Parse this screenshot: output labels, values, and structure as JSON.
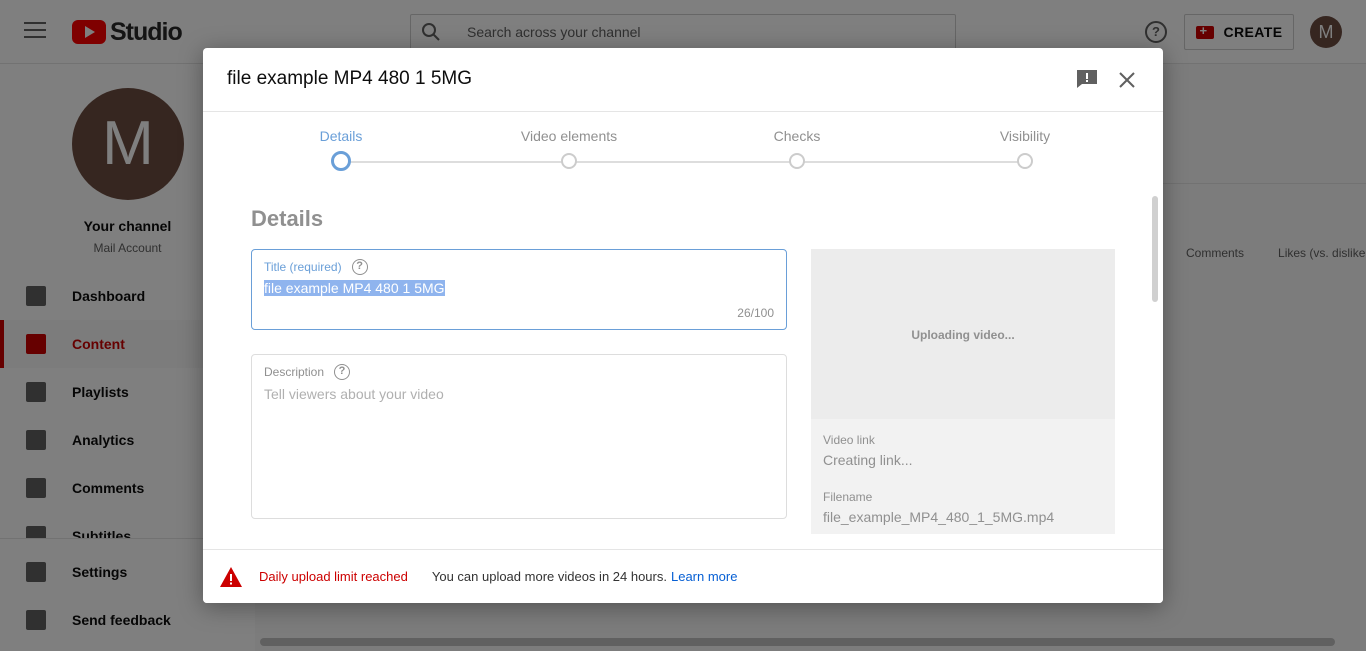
{
  "topbar": {
    "studio_label": "Studio",
    "search_placeholder": "Search across your channel",
    "create_label": "CREATE",
    "avatar_letter": "M"
  },
  "sidebar": {
    "avatar_letter": "M",
    "your_channel": "Your channel",
    "account_name": "Mail Account",
    "items": [
      {
        "label": "Dashboard",
        "icon": "dashboard-icon"
      },
      {
        "label": "Content",
        "icon": "content-icon",
        "active": true
      },
      {
        "label": "Playlists",
        "icon": "playlists-icon"
      },
      {
        "label": "Analytics",
        "icon": "analytics-icon"
      },
      {
        "label": "Comments",
        "icon": "comments-icon"
      },
      {
        "label": "Subtitles",
        "icon": "subtitles-icon"
      }
    ],
    "bottom_items": [
      {
        "label": "Settings",
        "icon": "gear-icon"
      },
      {
        "label": "Send feedback",
        "icon": "feedback-icon"
      }
    ]
  },
  "content": {
    "columns": [
      "Comments",
      "Likes (vs. dislike..."
    ]
  },
  "dialog": {
    "title": "file example MP4 480 1 5MG",
    "steps": [
      "Details",
      "Video elements",
      "Checks",
      "Visibility"
    ],
    "active_step": "Details",
    "section_title": "Details",
    "title_field": {
      "label": "Title (required)",
      "value": "file example MP4 480 1 5MG",
      "counter": "26/100"
    },
    "description_field": {
      "label": "Description",
      "placeholder": "Tell viewers about your video"
    },
    "preview": {
      "status": "Uploading video...",
      "video_link_label": "Video link",
      "video_link_value": "Creating link...",
      "filename_label": "Filename",
      "filename_value": "file_example_MP4_480_1_5MG.mp4"
    },
    "footer": {
      "warning_title": "Daily upload limit reached",
      "warning_text": "You can upload more videos in 24 hours.",
      "learn_more": "Learn more"
    }
  },
  "colors": {
    "accent_red": "#cc0000",
    "link_blue": "#065fd4",
    "focus_blue": "#6a9fd8"
  }
}
